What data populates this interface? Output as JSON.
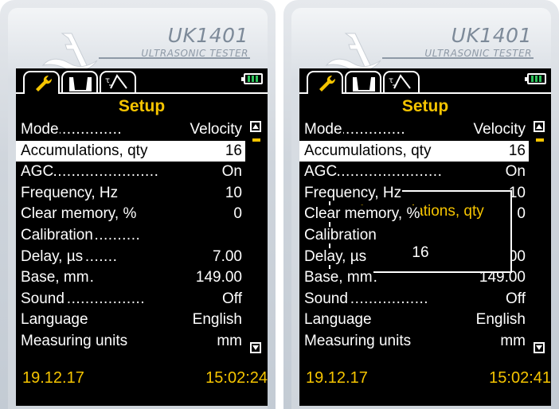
{
  "brand": {
    "model": "UK1401",
    "subtitle": "ULTRASONIC TESTER"
  },
  "screen": {
    "title": "Setup",
    "tabs": [
      {
        "icon": "wrench-icon",
        "active": true
      },
      {
        "icon": "waveform-icon",
        "active": false
      },
      {
        "icon": "time-probe-icon",
        "active": false
      }
    ],
    "battery": {
      "level": 1.0,
      "color": "#2ec35b"
    },
    "menu": [
      {
        "label": "Mode",
        "dots": "......................",
        "value": "Velocity"
      },
      {
        "label": "Accumulations, qty",
        "dots": "..........",
        "value": "16"
      },
      {
        "label": "AGC",
        "dots": "..............................",
        "value": "On"
      },
      {
        "label": "Frequency, Hz",
        "dots": "...............",
        "value": "10"
      },
      {
        "label": "Clear memory, %",
        "dots": "............",
        "value": "0"
      },
      {
        "label": "Calibration",
        "dots": "..........................",
        "value": ""
      },
      {
        "label": "Delay, µs",
        "dots": ".....................",
        "value": "7.00"
      },
      {
        "label": "Base, mm",
        "dots": "................",
        "value": "149.00"
      },
      {
        "label": "Sound",
        "dots": "...........................",
        "value": "Off"
      },
      {
        "label": "Language",
        "dots": "...............",
        "value": "English"
      },
      {
        "label": "Measuring units",
        "dots": "...........",
        "value": "mm"
      }
    ],
    "selected_index": 1,
    "accent_color": "#f5c400"
  },
  "left": {
    "date": "19.12.17",
    "time": "15:02:24"
  },
  "right": {
    "date": "19.12.17",
    "time": "15:02:41",
    "dialog": {
      "title": "Accumulations, qty",
      "value": "16"
    }
  }
}
